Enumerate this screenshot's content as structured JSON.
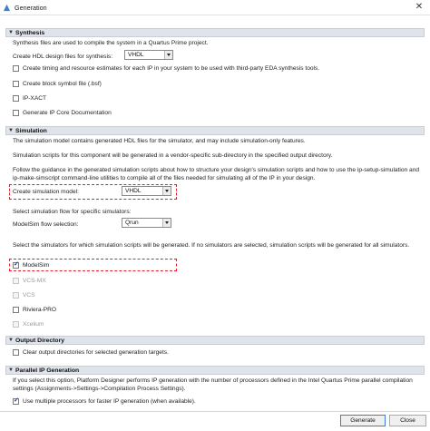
{
  "window": {
    "title": "Generation",
    "close_glyph": "✕",
    "icon": "app-icon"
  },
  "synthesis": {
    "header": "Synthesis",
    "description": "Synthesis files are used to compile the system in a Quartus Prime project.",
    "hdl_label": "Create HDL design files for synthesis:",
    "hdl_value": "VHDL",
    "options": [
      {
        "label": "Create timing and resource estimates for each IP in your system to be used with third-party EDA synthesis tools.",
        "checked": false
      },
      {
        "label": "Create block symbol file (.bsf)",
        "checked": false
      },
      {
        "label": "IP-XACT",
        "checked": false
      },
      {
        "label": "Generate IP Core Documentation",
        "checked": false
      }
    ]
  },
  "simulation": {
    "header": "Simulation",
    "desc1": "The simulation model contains generated HDL files for the simulator, and may include simulation-only features.",
    "desc2": "Simulation scripts for this component will be generated in a vendor-specific sub-directory in the specified output directory.",
    "desc3": "Follow the guidance in the generated simulation scripts about how to structure your design's simulation scripts and how to use the ip-setup-simulation and ip-make-simscript command-line utilities to compile all of the files needed for simulating all of the IP in your design.",
    "model_label": "Create simulation model:",
    "model_value": "VHDL",
    "flow_intro": "Select simulation flow for specific simulators:",
    "modelsim_flow_label": "ModelSim flow selection:",
    "modelsim_flow_value": "Qrun",
    "sim_intro": "Select the simulators for which simulation scripts will be generated. If no simulators are selected, simulation scripts will be generated for all simulators.",
    "simulators": [
      {
        "label": "ModelSim",
        "checked": true,
        "enabled": true
      },
      {
        "label": "VCS-MX",
        "checked": false,
        "enabled": false
      },
      {
        "label": "VCS",
        "checked": false,
        "enabled": false
      },
      {
        "label": "Riviera-PRO",
        "checked": false,
        "enabled": true
      },
      {
        "label": "Xcelium",
        "checked": false,
        "enabled": false
      }
    ]
  },
  "output_directory": {
    "header": "Output Directory",
    "clear_label": "Clear output directories for selected generation targets."
  },
  "parallel": {
    "header": "Parallel IP Generation",
    "description": "If you select this option, Platform Designer performs IP generation with the number of processors defined in the Intel Quartus Prime parallel compilation settings (Assignments->Settings->Compilation Process Settings).",
    "multi_label": "Use multiple processors for faster IP generation (when available)."
  },
  "buttons": {
    "generate": "Generate",
    "close": "Close"
  },
  "colors": {
    "section_header_bg": "#dfe3ea",
    "highlight": "#e0202a"
  }
}
